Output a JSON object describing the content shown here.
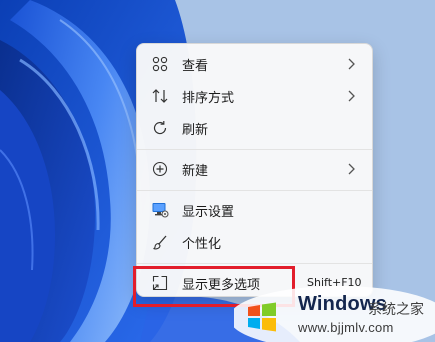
{
  "context_menu": {
    "items": [
      {
        "label": "查看",
        "icon": "grid-view-icon",
        "has_submenu": true
      },
      {
        "label": "排序方式",
        "icon": "sort-arrows-icon",
        "has_submenu": true
      },
      {
        "label": "刷新",
        "icon": "refresh-icon",
        "has_submenu": false
      },
      {
        "label": "新建",
        "icon": "new-plus-circle-icon",
        "has_submenu": true
      },
      {
        "label": "显示设置",
        "icon": "display-settings-icon",
        "has_submenu": false
      },
      {
        "label": "个性化",
        "icon": "paintbrush-icon",
        "has_submenu": false
      },
      {
        "label": "显示更多选项",
        "icon": "show-more-options-icon",
        "has_submenu": false,
        "shortcut": "Shift+F10",
        "highlighted": true
      }
    ]
  },
  "watermark": {
    "brand": "Windows",
    "site_name": "系统之家",
    "url": "www.bjjmlv.com"
  },
  "colors": {
    "highlight_box": "#e21d2b",
    "wallpaper_blue": "#1f56d6",
    "menu_background": "#f9f9f9"
  }
}
